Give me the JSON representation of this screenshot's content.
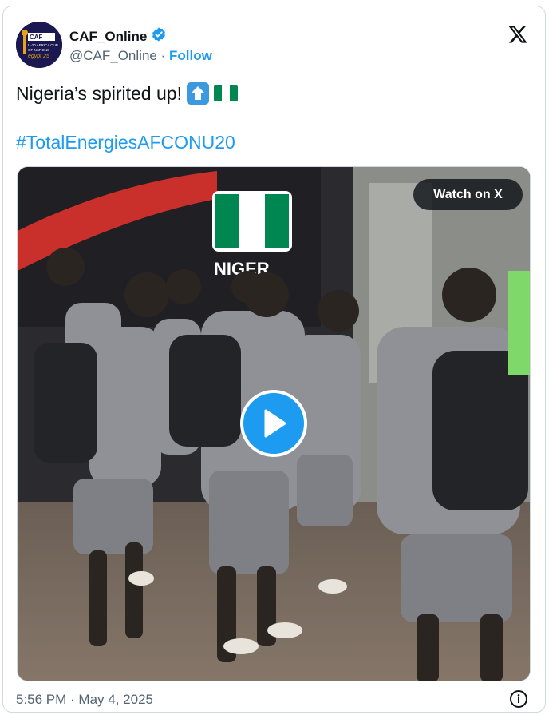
{
  "author": {
    "display_name": "CAF_Online",
    "handle": "@CAF_Online",
    "separator": "·",
    "follow_label": "Follow",
    "verified": true,
    "avatar_text": [
      "CAF",
      "U-20 AFRICA CUP",
      "OF NATIONS",
      "egypt 25"
    ]
  },
  "tweet": {
    "text": "Nigeria’s spirited up!",
    "emojis": [
      "up-arrow-button-emoji",
      "nigeria-flag-emoji"
    ],
    "hashtag": "#TotalEnergiesAFCONU20"
  },
  "media": {
    "type": "video",
    "watch_label": "Watch on X",
    "bus_text": "NIGER"
  },
  "footer": {
    "timestamp": "5:56 PM · May 4, 2025"
  },
  "colors": {
    "accent": "#1d9bf0",
    "text": "#0f1419",
    "muted": "#536471",
    "border": "#cfd9de",
    "nigeria_green": "#008751"
  }
}
